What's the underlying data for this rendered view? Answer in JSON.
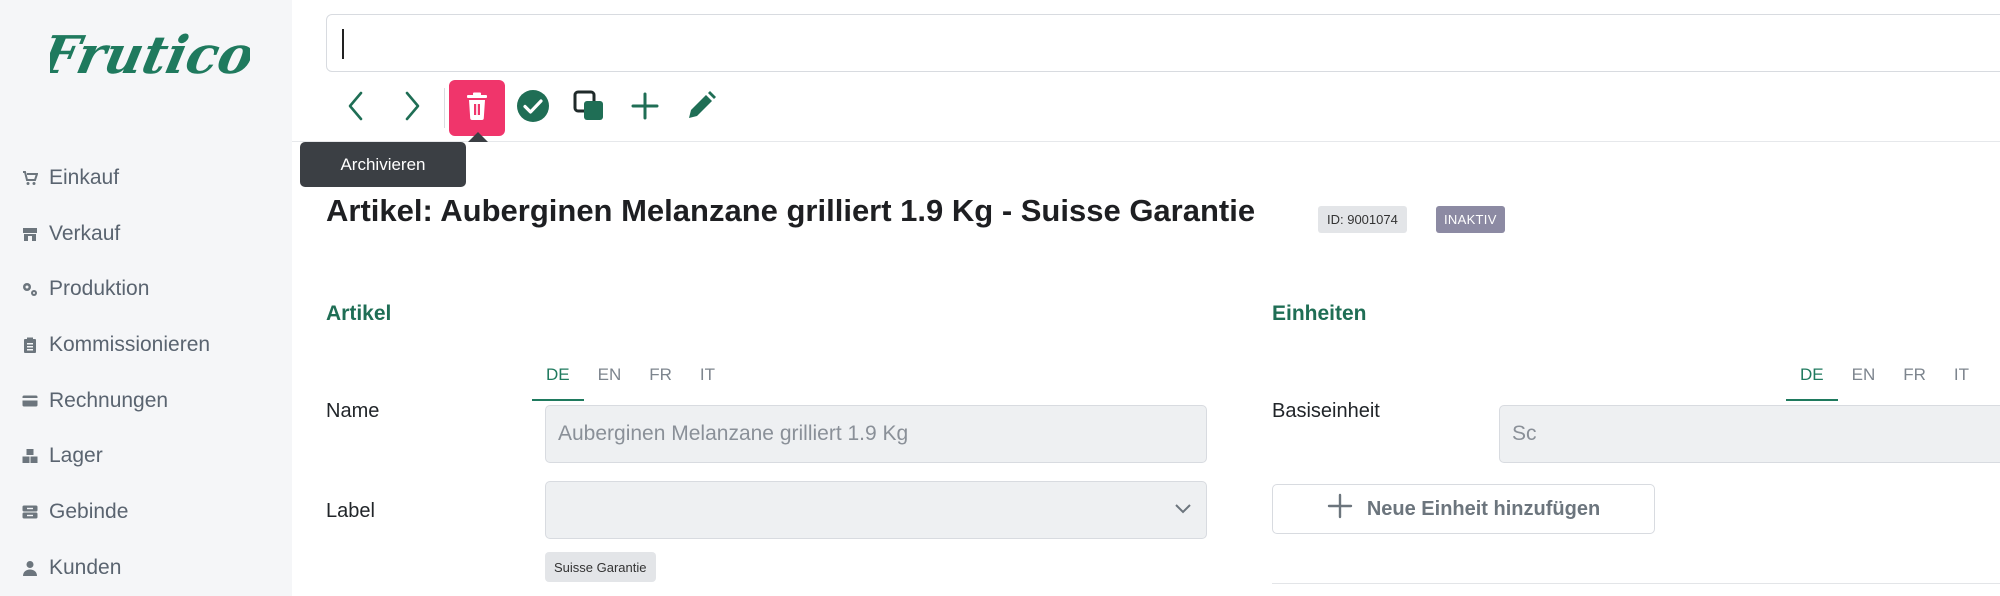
{
  "app": {
    "brand": "Frutico"
  },
  "sidebar": {
    "items": [
      {
        "label": "Einkauf",
        "icon": "cart-icon"
      },
      {
        "label": "Verkauf",
        "icon": "store-icon"
      },
      {
        "label": "Produktion",
        "icon": "gears-icon"
      },
      {
        "label": "Kommissionieren",
        "icon": "clipboard-icon"
      },
      {
        "label": "Rechnungen",
        "icon": "credit-card-icon"
      },
      {
        "label": "Lager",
        "icon": "boxes-icon"
      },
      {
        "label": "Gebinde",
        "icon": "container-icon"
      },
      {
        "label": "Kunden",
        "icon": "user-icon"
      }
    ]
  },
  "search": {
    "value": ""
  },
  "toolbar": {
    "buttons": [
      "chevron-left-icon",
      "chevron-right-icon",
      "trash-icon",
      "check-circle-icon",
      "clone-icon",
      "plus-icon",
      "pencil-icon"
    ],
    "tooltip": "Archivieren",
    "accent": "#f0356b"
  },
  "page": {
    "title": "Artikel: Auberginen Melanzane grilliert 1.9 Kg - Suisse Garantie",
    "id_badge": "ID: 9001074",
    "status_badge": "INAKTIV"
  },
  "artikel": {
    "heading": "Artikel",
    "languages": [
      "DE",
      "EN",
      "FR",
      "IT"
    ],
    "active_language": "DE",
    "name_label": "Name",
    "name_value": "Auberginen Melanzane grilliert 1.9  Kg",
    "label_label": "Label",
    "label_value": "",
    "label_chip": "Suisse Garantie"
  },
  "einheiten": {
    "heading": "Einheiten",
    "languages": [
      "DE",
      "EN",
      "FR",
      "IT"
    ],
    "active_language": "DE",
    "base_label": "Basiseinheit",
    "base_value": "Sc",
    "add_button": "Neue Einheit hinzufügen"
  },
  "colors": {
    "brand": "#1f7a5e",
    "heading": "#1f6e55",
    "danger": "#f0356b"
  }
}
